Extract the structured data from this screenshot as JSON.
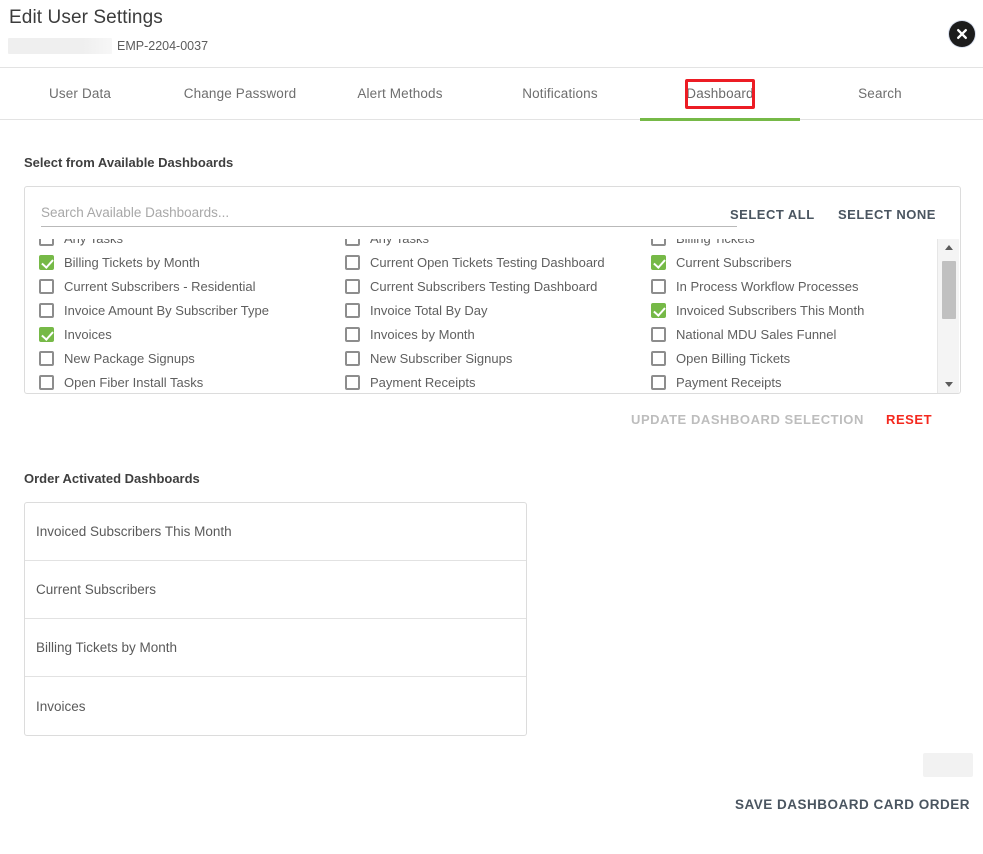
{
  "header": {
    "title": "Edit User Settings",
    "employee_id": "EMP-2204-0037",
    "close_icon": "close-circle-icon"
  },
  "tabs": [
    {
      "label": "User Data",
      "active": false
    },
    {
      "label": "Change Password",
      "active": false
    },
    {
      "label": "Alert Methods",
      "active": false
    },
    {
      "label": "Notifications",
      "active": false
    },
    {
      "label": "Dashboard",
      "active": true,
      "highlighted": true
    },
    {
      "label": "Search",
      "active": false
    }
  ],
  "available_section": {
    "label": "Select from Available Dashboards",
    "search": {
      "placeholder": "Search Available Dashboards...",
      "value": ""
    },
    "select_all_label": "SELECT ALL",
    "select_none_label": "SELECT NONE",
    "columns": [
      [
        {
          "label": "Any Tasks",
          "checked": false
        },
        {
          "label": "Billing Tickets by Month",
          "checked": true
        },
        {
          "label": "Current Subscribers - Residential",
          "checked": false
        },
        {
          "label": "Invoice Amount By Subscriber Type",
          "checked": false
        },
        {
          "label": "Invoices",
          "checked": true
        },
        {
          "label": "New Package Signups",
          "checked": false
        },
        {
          "label": "Open Fiber Install Tasks",
          "checked": false
        }
      ],
      [
        {
          "label": "Any Tasks",
          "checked": false
        },
        {
          "label": "Current Open Tickets Testing Dashboard",
          "checked": false
        },
        {
          "label": "Current Subscribers Testing Dashboard",
          "checked": false
        },
        {
          "label": "Invoice Total By Day",
          "checked": false
        },
        {
          "label": "Invoices by Month",
          "checked": false
        },
        {
          "label": "New Subscriber Signups",
          "checked": false
        },
        {
          "label": "Payment Receipts",
          "checked": false
        }
      ],
      [
        {
          "label": "Billing Tickets",
          "checked": false
        },
        {
          "label": "Current Subscribers",
          "checked": true
        },
        {
          "label": "In Process Workflow Processes",
          "checked": false
        },
        {
          "label": "Invoiced Subscribers This Month",
          "checked": true
        },
        {
          "label": "National MDU Sales Funnel",
          "checked": false
        },
        {
          "label": "Open Billing Tickets",
          "checked": false
        },
        {
          "label": "Payment Receipts",
          "checked": false
        }
      ]
    ],
    "scrollbar": {
      "up_icon": "chevron-up-icon",
      "down_icon": "chevron-down-icon"
    },
    "update_button": "UPDATE DASHBOARD SELECTION",
    "reset_button": "RESET"
  },
  "order_section": {
    "label": "Order Activated Dashboards",
    "cards": [
      "Invoiced Subscribers This Month",
      "Current Subscribers",
      "Billing Tickets by Month",
      "Invoices"
    ]
  },
  "footer": {
    "save_label": "SAVE DASHBOARD CARD ORDER"
  },
  "colors": {
    "accent_green": "#76b947",
    "annotation_red": "#ec1c24",
    "reset_red": "#f4281e",
    "disabled_gray": "#bdbdbd",
    "text_dark": "#4a5560"
  }
}
